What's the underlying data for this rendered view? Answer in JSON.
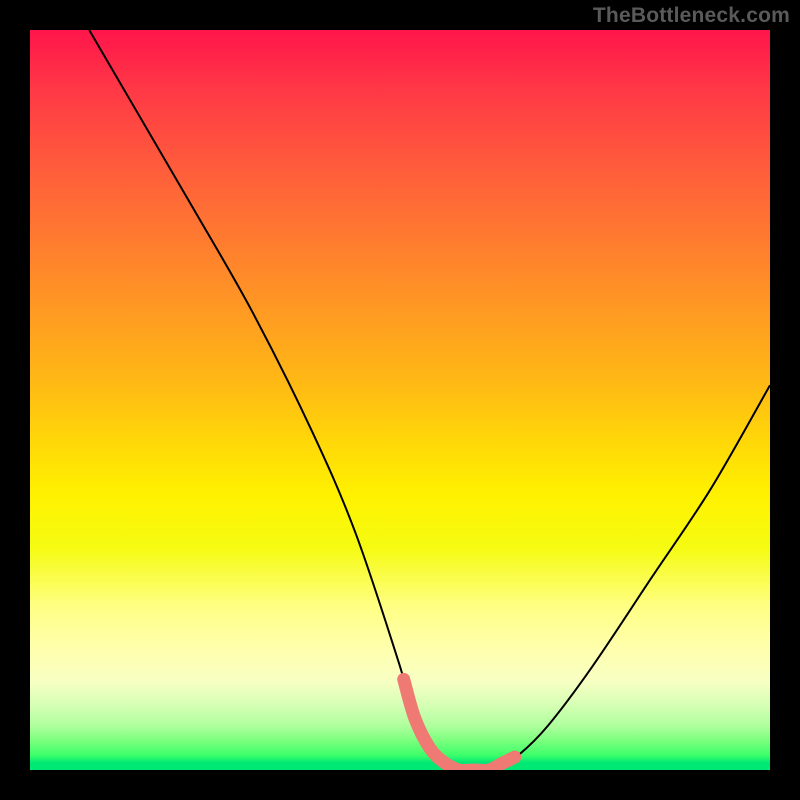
{
  "watermark": "TheBottleneck.com",
  "chart_data": {
    "type": "line",
    "title": "",
    "xlabel": "",
    "ylabel": "",
    "xlim": [
      0,
      100
    ],
    "ylim": [
      0,
      100
    ],
    "series": [
      {
        "name": "bottleneck-curve",
        "x": [
          8,
          15,
          22,
          30,
          38,
          44,
          50,
          52,
          54,
          56,
          58,
          60,
          62,
          64,
          66,
          70,
          76,
          84,
          92,
          100
        ],
        "values": [
          100,
          88,
          76,
          62,
          46,
          32,
          14,
          7,
          3,
          1,
          0,
          0,
          0,
          1,
          2,
          6,
          14,
          26,
          38,
          52
        ]
      }
    ],
    "highlight": {
      "name": "minimum-plateau",
      "x_range": [
        50.5,
        65.5
      ],
      "color": "#ef7a73"
    },
    "background_gradient": {
      "top": "#ff154b",
      "bottom": "#00e874"
    }
  }
}
